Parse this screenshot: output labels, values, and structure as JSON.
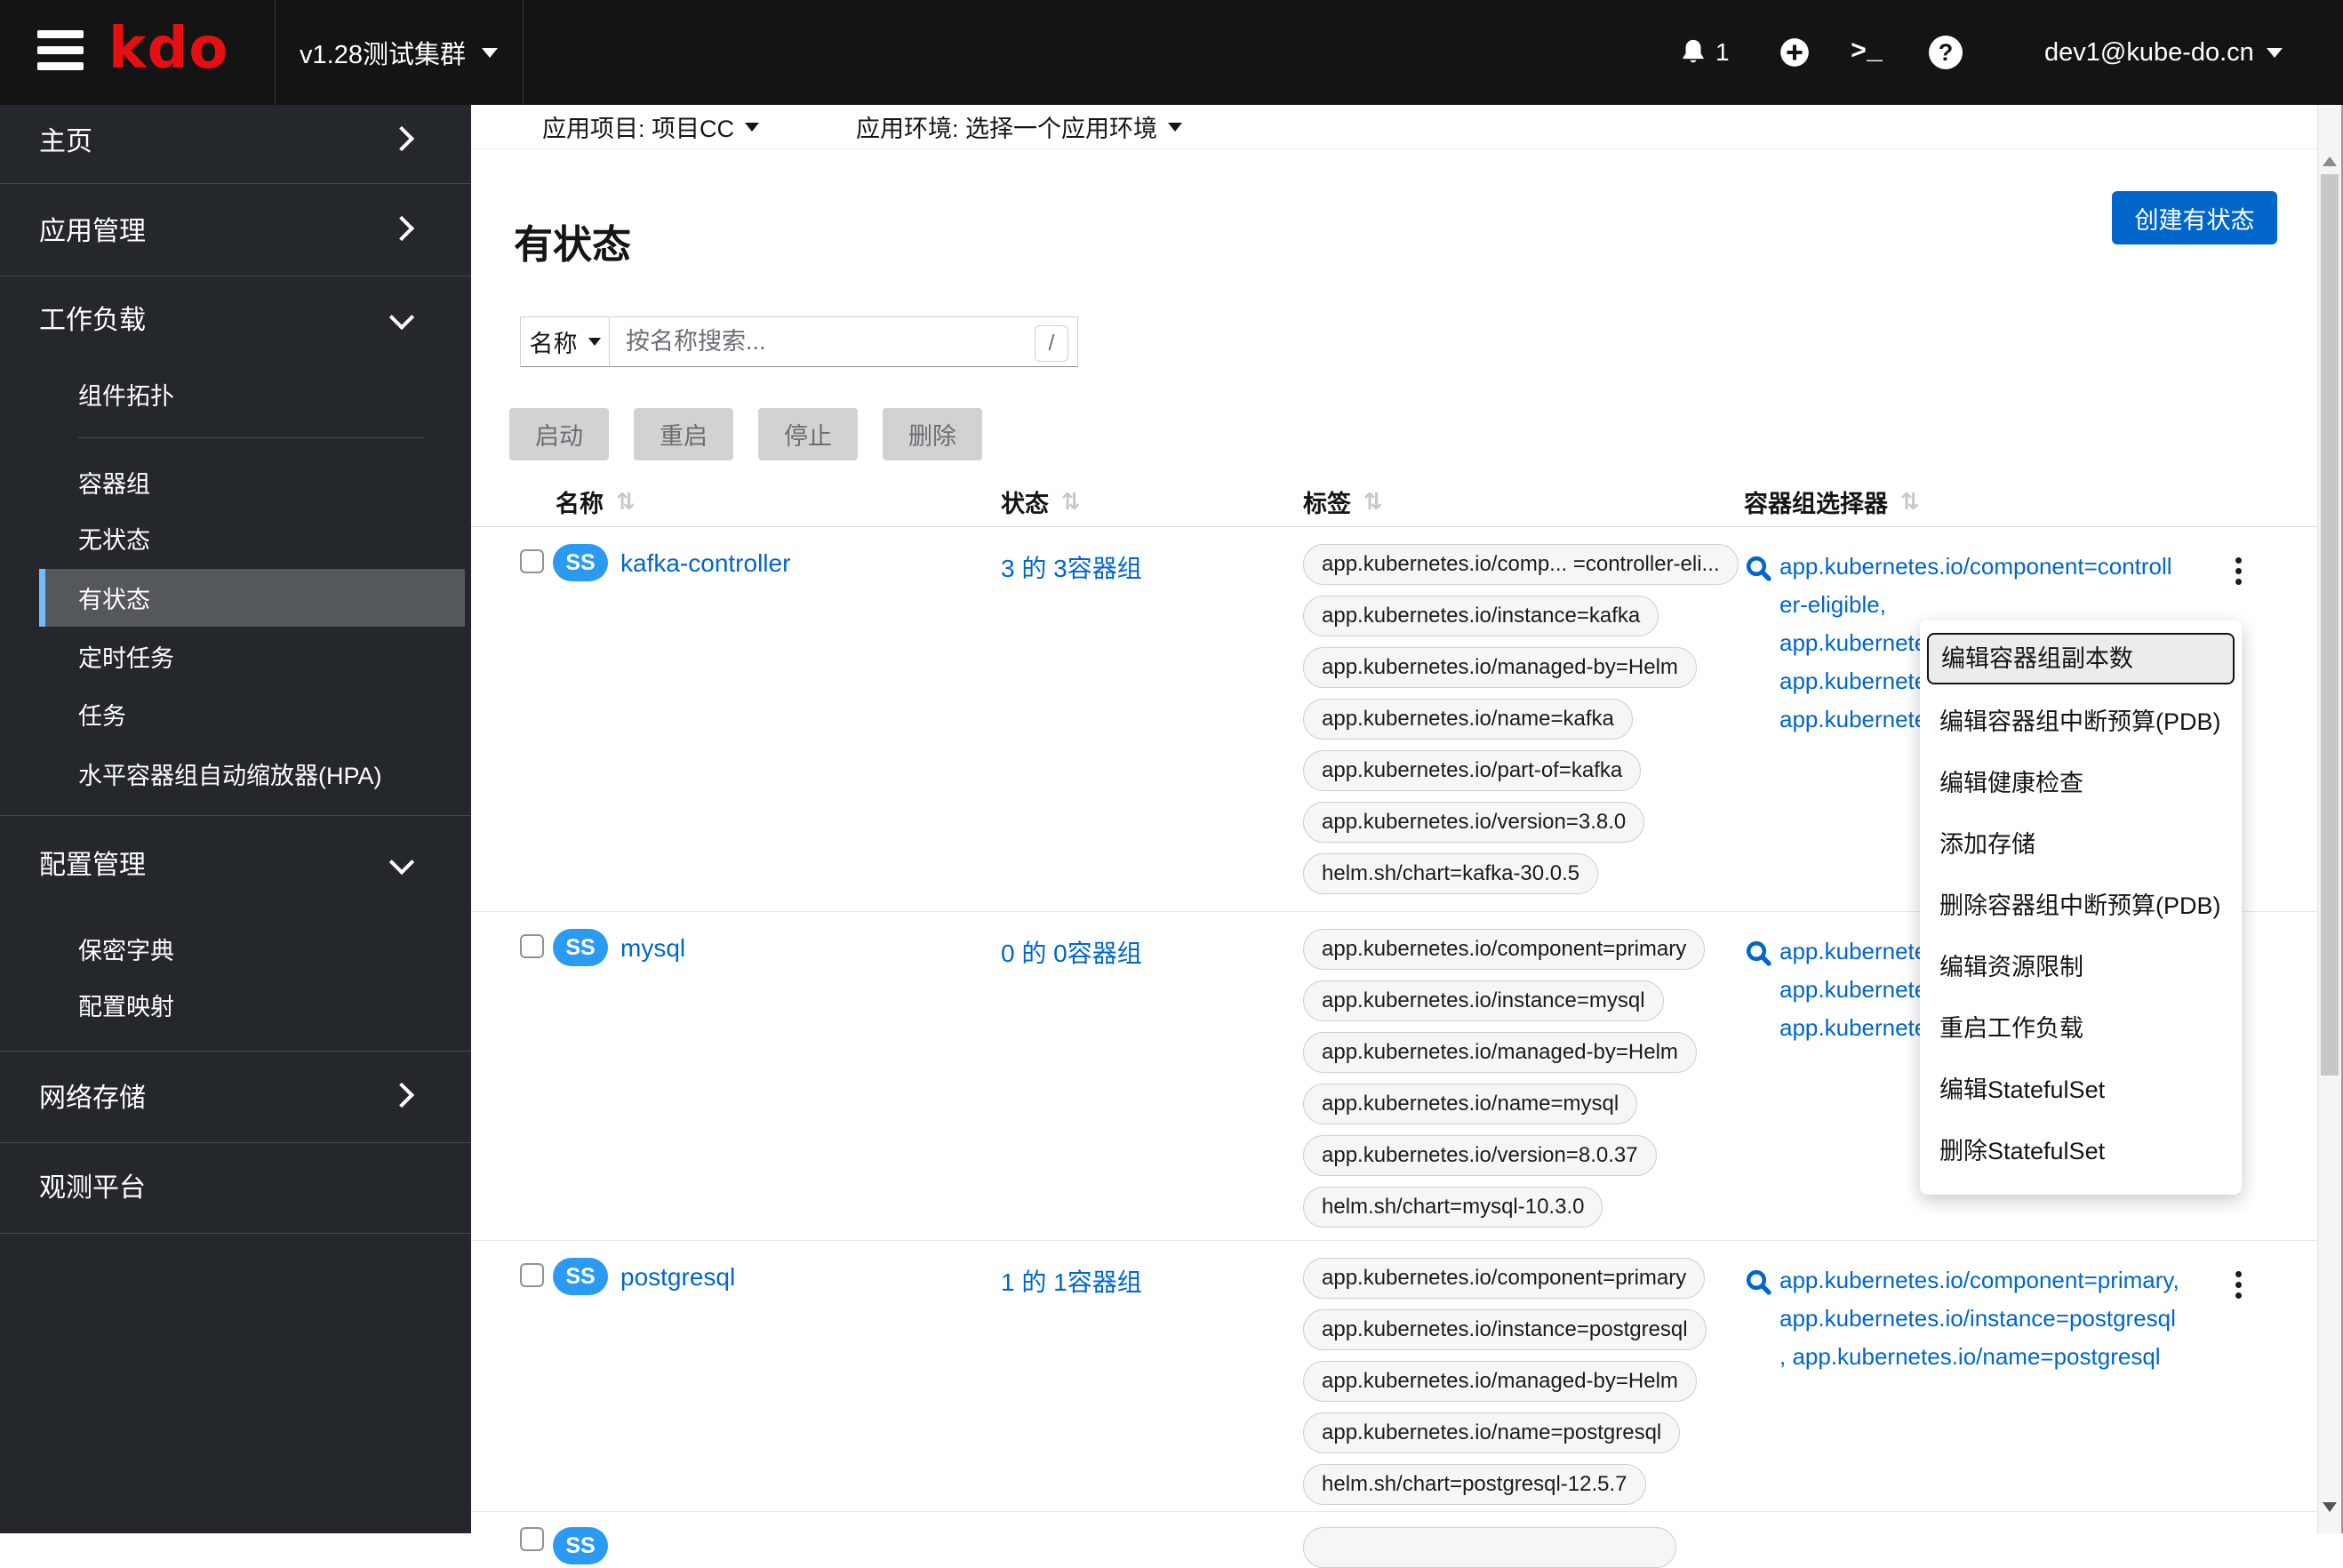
{
  "masthead": {
    "logo_text": "kdo",
    "cluster_selector": "v1.28测试集群",
    "notification_count": "1",
    "terminal_glyph": ">_",
    "help_glyph": "?",
    "user_menu": "dev1@kube-do.cn"
  },
  "sidebar": {
    "home": "主页",
    "app_management": "应用管理",
    "workloads": "工作负载",
    "topology": "组件拓扑",
    "pods": "容器组",
    "stateless": "无状态",
    "stateful": "有状态",
    "cronjobs": "定时任务",
    "jobs": "任务",
    "hpa": "水平容器组自动缩放器(HPA)",
    "config_management": "配置管理",
    "secrets": "保密字典",
    "configmaps": "配置映射",
    "network_storage": "网络存储",
    "observability": "观测平台"
  },
  "toolbar": {
    "project_label": "应用项目: 项目CC",
    "env_label": "应用环境: 选择一个应用环境"
  },
  "page": {
    "title": "有状态",
    "create_button": "创建有状态"
  },
  "filters": {
    "attribute_select": "名称",
    "search_placeholder": "按名称搜索...",
    "shortcut_hint": "/"
  },
  "actions": {
    "start": "启动",
    "restart": "重启",
    "stop": "停止",
    "delete": "删除"
  },
  "table": {
    "headers": {
      "name": "名称",
      "status": "状态",
      "labels": "标签",
      "selector": "容器组选择器"
    },
    "sort_glyph": "⇅",
    "badge": "SS",
    "rows": [
      {
        "name": "kafka-controller",
        "status": "3 的 3容器组",
        "tags": [
          "app.kubernetes.io/comp... =controller-eli...",
          "app.kubernetes.io/instance=kafka",
          "app.kubernetes.io/managed-by=Helm",
          "app.kubernetes.io/name=kafka",
          "app.kubernetes.io/part-of=kafka",
          "app.kubernetes.io/version=3.8.0",
          "helm.sh/chart=kafka-30.0.5"
        ],
        "selector_lines": [
          "app.kubernetes.io/component=controll",
          "er-eligible,",
          "app.kubernetes.io/instance=kafka,",
          "app.kubernetes.io/name=kafka,",
          "app.kubernetes.io/part-of=kafka"
        ]
      },
      {
        "name": "mysql",
        "status": "0 的 0容器组",
        "tags": [
          "app.kubernetes.io/component=primary",
          "app.kubernetes.io/instance=mysql",
          "app.kubernetes.io/managed-by=Helm",
          "app.kubernetes.io/name=mysql",
          "app.kubernetes.io/version=8.0.37",
          "helm.sh/chart=mysql-10.3.0"
        ],
        "selector_lines": [
          "app.kubernetes.io/component=primary,",
          "app.kubernetes.io/instance=mysql,",
          "app.kubernetes.io/name=mysql"
        ]
      },
      {
        "name": "postgresql",
        "status": "1 的 1容器组",
        "tags": [
          "app.kubernetes.io/component=primary",
          "app.kubernetes.io/instance=postgresql",
          "app.kubernetes.io/managed-by=Helm",
          "app.kubernetes.io/name=postgresql",
          "helm.sh/chart=postgresql-12.5.7"
        ],
        "selector_lines": [
          "app.kubernetes.io/component=primary,",
          "app.kubernetes.io/instance=postgresql",
          ", app.kubernetes.io/name=postgresql"
        ]
      }
    ]
  },
  "context_menu": {
    "items": [
      "编辑容器组副本数",
      "编辑容器组中断预算(PDB)",
      "编辑健康检查",
      "添加存储",
      "删除容器组中断预算(PDB)",
      "编辑资源限制",
      "重启工作负载",
      "编辑StatefulSet",
      "删除StatefulSet"
    ]
  },
  "colors": {
    "primary": "#0066cc",
    "link": "#0066cc",
    "badge_blue": "#2b9af3",
    "nav_selected_border": "#73bcf7",
    "masthead_bg": "#141414",
    "sidebar_bg": "#24272b"
  }
}
